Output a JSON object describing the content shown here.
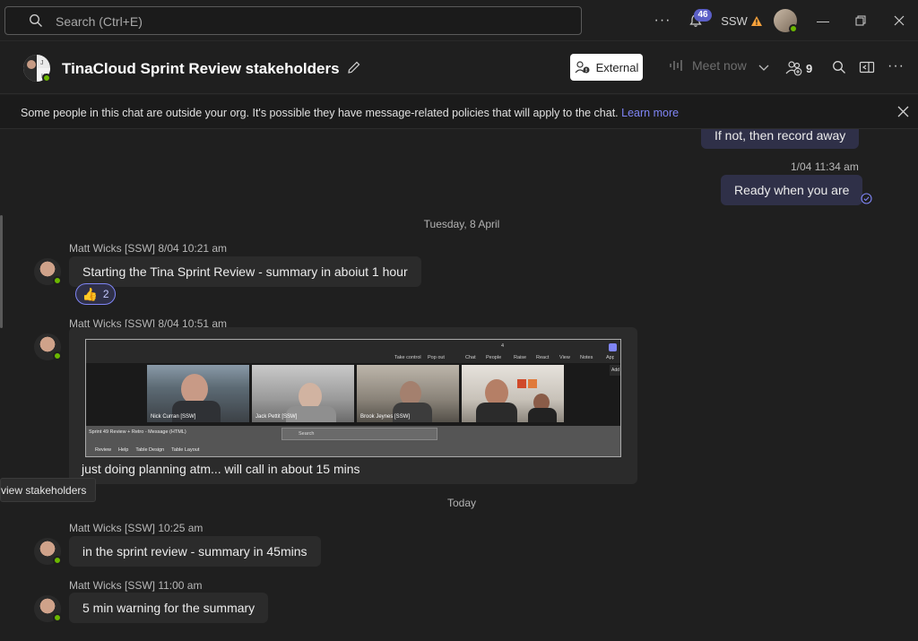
{
  "topbar": {
    "search_placeholder": "Search (Ctrl+E)",
    "notifications_count": "46",
    "org_label": "SSW"
  },
  "header": {
    "chat_title": "TinaCloud Sprint Review stakeholders",
    "external_label": "External",
    "meet_now_label": "Meet now",
    "participants_count": "9"
  },
  "banner": {
    "text": "Some people in this chat are outside your org. It's possible they have message-related policies that will apply to the chat.",
    "link": "Learn more"
  },
  "messages": {
    "prev_own_text": "If not, then record away",
    "own_time": "1/04 11:34 am",
    "own_text": "Ready when you are",
    "date1": "Tuesday, 8 April",
    "m1_meta": "Matt Wicks [SSW]   8/04 10:21 am",
    "m1_text": "Starting the Tina Sprint Review - summary in aboiut 1 hour",
    "m1_reaction_count": "2",
    "m2_meta": "Matt Wicks [SSW]   8/04 10:51 am",
    "m2_text": "just doing planning atm... will call in about 15 mins",
    "date2": "Today",
    "m3_meta": "Matt Wicks [SSW]   10:25 am",
    "m3_text": "in the sprint review - summary in 45mins",
    "m4_meta": "Matt Wicks [SSW]   11:00 am",
    "m4_text": "5 min warning for the summary"
  },
  "screenshot": {
    "toolbar": [
      "Take control",
      "Pop out",
      "Chat",
      "People",
      "Raise",
      "React",
      "View",
      "Notes",
      "Apps"
    ],
    "people_count": "4",
    "tooltip": "Add",
    "participants": [
      "Nick Curran [SSW]",
      "Jack Pettit [SSW]",
      "Brook Jeynes [SSW]"
    ],
    "doc_title": "Sprint 49 Review + Retro - Message (HTML)",
    "search_label": "Search",
    "ribbon": [
      "Review",
      "Help",
      "Table Design",
      "Table Layout"
    ]
  },
  "tooltip": {
    "text": "view stakeholders"
  }
}
